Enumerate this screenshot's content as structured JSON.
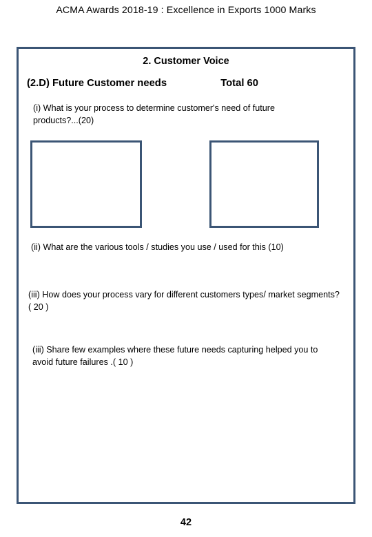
{
  "theme": {
    "border_color": "#3b5575",
    "page_background": "#ffffff",
    "text_color": "#000000"
  },
  "slide": {
    "title": "ACMA  Awards  2018-19 : Excellence in Exports 1000 Marks",
    "page_number": "42"
  },
  "section": {
    "heading": "2. Customer Voice",
    "subsection_label": "(2.D)  Future  Customer  needs",
    "subsection_total": "Total  60"
  },
  "questions": [
    {
      "id": "i",
      "text": "(i) What is your process to determine customer's need of future products?...(20)",
      "marks": "20"
    },
    {
      "id": "ii",
      "text": "(ii) What  are the  various  tools / studies  you  use /  used   for this (10)",
      "marks": "10"
    },
    {
      "id": "iii",
      "text": "(iii) How does your process vary for different customers types/ market segments? ( 20 )",
      "marks": "20"
    },
    {
      "id": "iii-b",
      "text": "(iii)  Share  few  examples  where  these  future  needs  capturing  helped  you  to avoid  future  failures .( 10 )",
      "marks": "10"
    }
  ],
  "answer_boxes": [
    {
      "name": "answer-box-left",
      "value": "",
      "placeholder": ""
    },
    {
      "name": "answer-box-right",
      "value": "",
      "placeholder": ""
    }
  ]
}
